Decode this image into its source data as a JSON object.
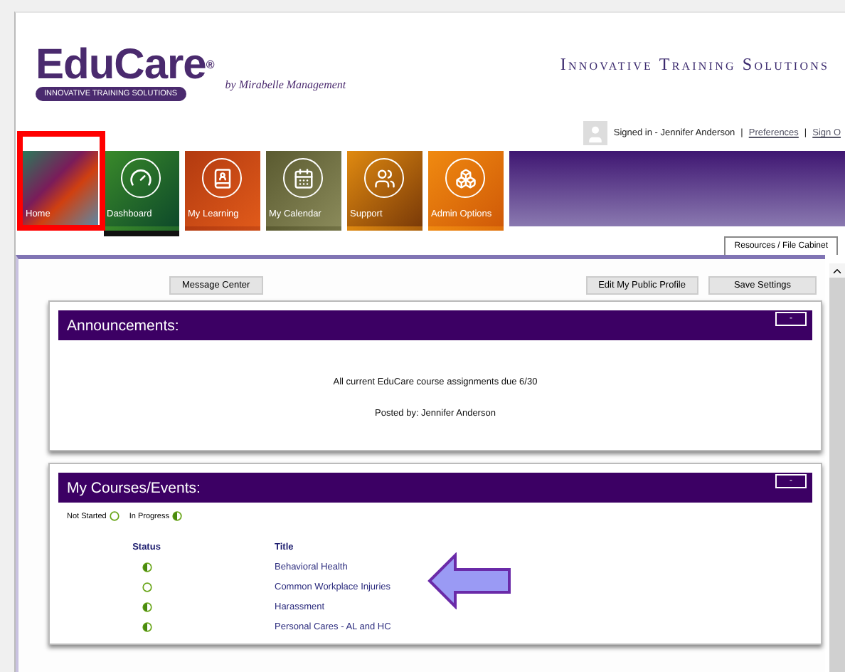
{
  "header": {
    "logo": {
      "name": "EduCare",
      "mark": "®",
      "tagline": "INNOVATIVE TRAINING SOLUTIONS",
      "byline": "by Mirabelle Management"
    },
    "title": "Innovative Training Solutions"
  },
  "user_bar": {
    "signed_in": "Signed in - Jennifer Anderson",
    "separator_1": "|",
    "preferences": "Preferences",
    "separator_2": "|",
    "sign_out": "Sign O"
  },
  "nav_tiles": [
    {
      "label": "Home",
      "kind": "photo",
      "selected": false
    },
    {
      "label": "Dashboard",
      "kind": "gauge",
      "selected": true
    },
    {
      "label": "My Learning",
      "kind": "learning",
      "selected": false
    },
    {
      "label": "My Calendar",
      "kind": "calendar",
      "selected": false
    },
    {
      "label": "Support",
      "kind": "people",
      "selected": false
    },
    {
      "label": "Admin Options",
      "kind": "admin",
      "selected": false
    }
  ],
  "resources_tab": "Resources / File Cabinet",
  "buttons": {
    "message_center": "Message Center",
    "edit_profile": "Edit My Public Profile",
    "save_settings": "Save Settings"
  },
  "announcements": {
    "title": "Announcements:",
    "collapse": "-",
    "message": "All current EduCare course assignments due 6/30",
    "posted_by": "Posted by: Jennifer Anderson"
  },
  "courses": {
    "title": "My Courses/Events:",
    "collapse": "-",
    "legend": [
      {
        "label": "Not Started",
        "kind": "not_started"
      },
      {
        "label": "In Progress",
        "kind": "in_progress"
      }
    ],
    "columns": [
      "Status",
      "Title"
    ],
    "rows": [
      {
        "kind": "in_progress",
        "title": "Behavioral Health"
      },
      {
        "kind": "not_started",
        "title": "Common Workplace Injuries"
      },
      {
        "kind": "in_progress",
        "title": "Harassment"
      },
      {
        "kind": "in_progress",
        "title": "Personal Cares - AL and HC"
      }
    ]
  }
}
